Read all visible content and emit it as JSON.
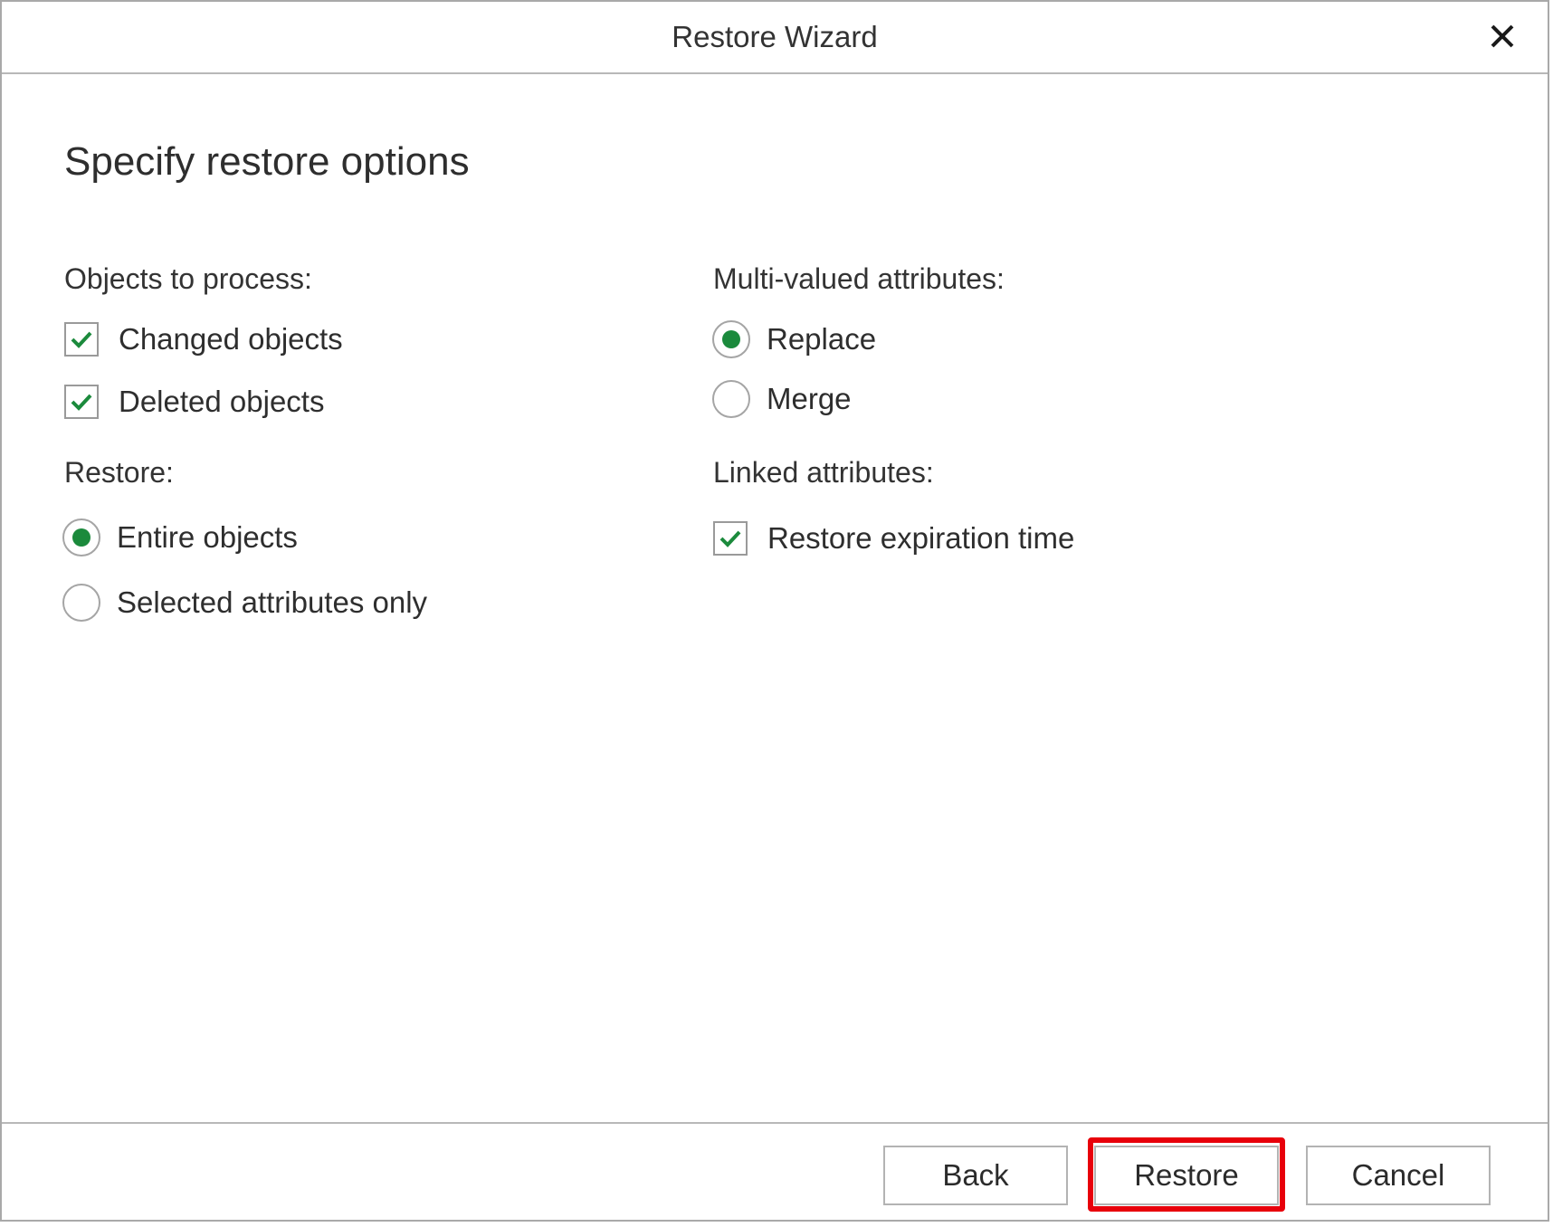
{
  "window": {
    "title": "Restore Wizard",
    "close_icon": "close-icon"
  },
  "page": {
    "heading": "Specify restore options"
  },
  "objects_to_process": {
    "label": "Objects to process:",
    "changed_objects": {
      "label": "Changed objects",
      "checked": true
    },
    "deleted_objects": {
      "label": "Deleted objects",
      "checked": true
    }
  },
  "restore": {
    "label": "Restore:",
    "entire_objects": {
      "label": "Entire objects",
      "selected": true
    },
    "selected_attributes_only": {
      "label": "Selected attributes only",
      "selected": false
    }
  },
  "multi_valued_attributes": {
    "label": "Multi-valued attributes:",
    "replace": {
      "label": "Replace",
      "selected": true
    },
    "merge": {
      "label": "Merge",
      "selected": false
    }
  },
  "linked_attributes": {
    "label": "Linked attributes:",
    "restore_expiration_time": {
      "label": "Restore expiration time",
      "checked": true
    }
  },
  "footer": {
    "back_label": "Back",
    "restore_label": "Restore",
    "cancel_label": "Cancel"
  },
  "colors": {
    "accent": "#1b8a3c",
    "highlight": "#e8000b"
  }
}
